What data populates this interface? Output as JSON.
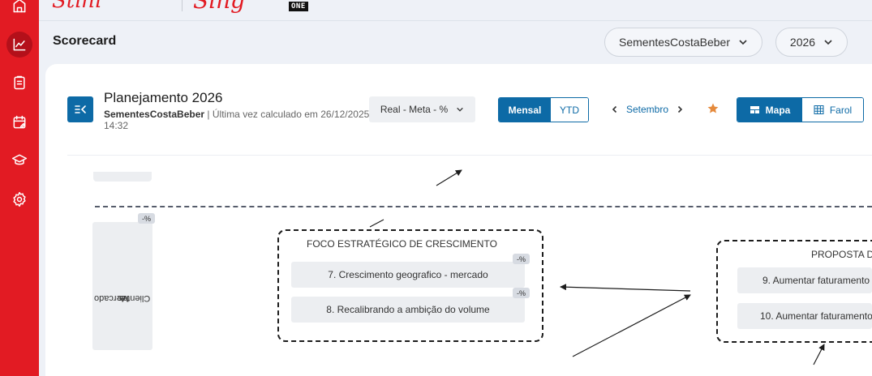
{
  "brand": {
    "logo_text": "Stihl",
    "logo2_text": "Sing",
    "badge": "ONE"
  },
  "sidebar": {
    "items": [
      {
        "name": "home-icon",
        "active": false
      },
      {
        "name": "chart-line-icon",
        "active": true
      },
      {
        "name": "clipboard-icon",
        "active": false
      },
      {
        "name": "calendar-edit-icon",
        "active": false
      },
      {
        "name": "graduation-cap-icon",
        "active": false
      },
      {
        "name": "gear-icon",
        "active": false
      }
    ]
  },
  "header": {
    "title": "Scorecard",
    "company_select": "SementesCostaBeber",
    "year_select": "2026"
  },
  "plan": {
    "title": "Planejamento 2026",
    "company": "SementesCostaBeber",
    "last_calc": "| Última vez calculado em 26/12/2025 14:32",
    "view_select": "Real - Meta - %",
    "period_toggle": {
      "monthly": "Mensal",
      "ytd": "YTD",
      "selected": "Mensal"
    },
    "month": "Setembro",
    "display_toggle": {
      "map": "Mapa",
      "farol": "Farol",
      "selected": "Mapa"
    }
  },
  "map": {
    "perspective": {
      "label_lines": [
        "Mercado",
        "e",
        "Clientes"
      ],
      "badge": "-%"
    },
    "groups": [
      {
        "title": "FOCO ESTRATÉGICO DE CRESCIMENTO",
        "objectives": [
          {
            "label": "7. Crescimento geografico - mercado",
            "badge": "-%"
          },
          {
            "label": "8.  Recalibrando a ambição do volume",
            "badge": "-%"
          }
        ]
      },
      {
        "title": "PROPOSTA DE",
        "objectives": [
          {
            "label": "9. Aumentar faturamento",
            "badge": ""
          },
          {
            "label": "10. Aumentar faturamento",
            "badge": ""
          }
        ]
      }
    ]
  },
  "colors": {
    "brand_red": "#e21b23",
    "primary_blue": "#0d6aa6",
    "star_orange": "#e58a3c"
  }
}
